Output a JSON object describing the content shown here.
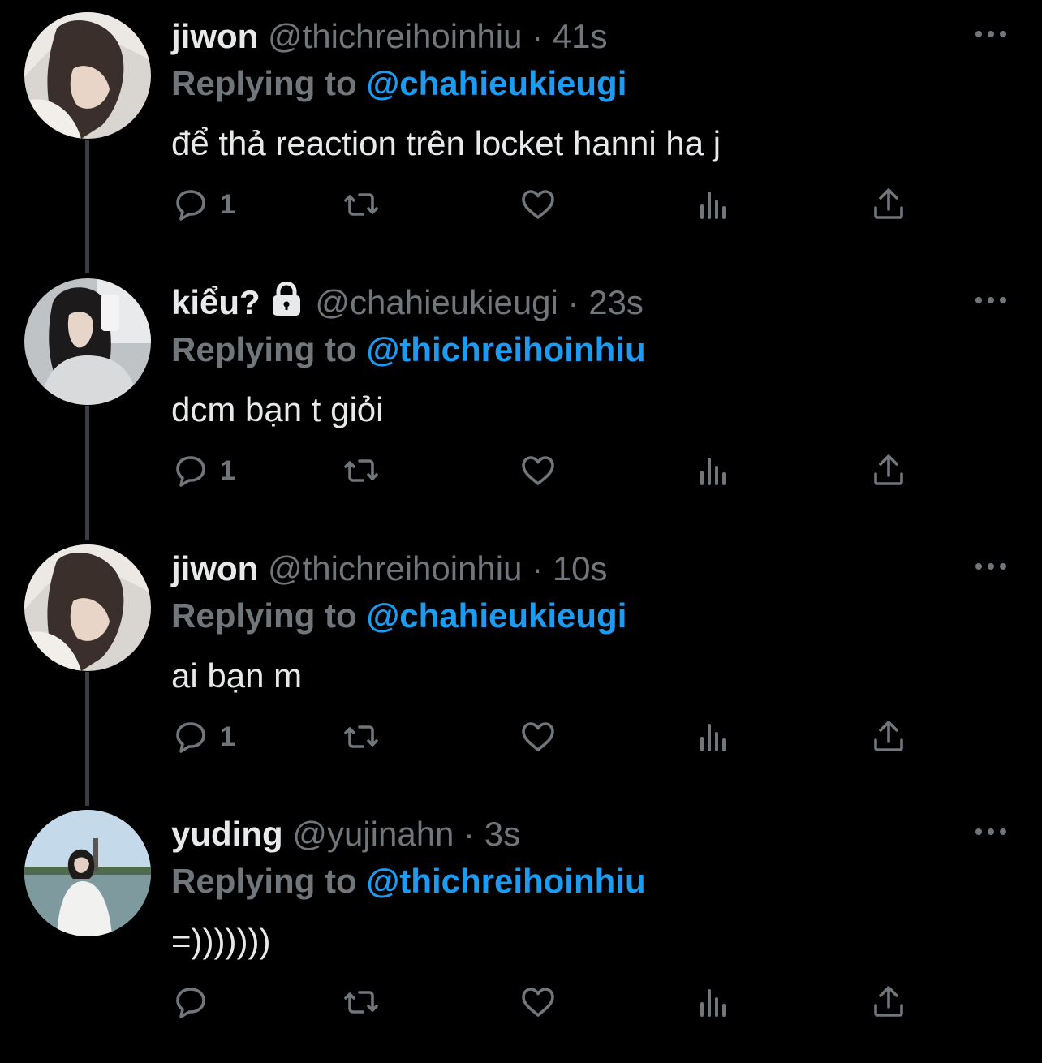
{
  "tweets": [
    {
      "name": "jiwon",
      "handle": "@thichreihoinhiu",
      "time": "41s",
      "locked": false,
      "replying_label": "Replying to",
      "mention": "@chahieukieugi",
      "text": "để thả reaction trên locket hanni ha j",
      "reply_count": "1"
    },
    {
      "name": "kiểu?",
      "handle": "@chahieukieugi",
      "time": "23s",
      "locked": true,
      "replying_label": "Replying to",
      "mention": "@thichreihoinhiu",
      "text": "dcm bạn t giỏi",
      "reply_count": "1"
    },
    {
      "name": "jiwon",
      "handle": "@thichreihoinhiu",
      "time": "10s",
      "locked": false,
      "replying_label": "Replying to",
      "mention": "@chahieukieugi",
      "text": "ai bạn m",
      "reply_count": "1"
    },
    {
      "name": "yuding",
      "handle": "@yujinahn",
      "time": "3s",
      "locked": false,
      "replying_label": "Replying to",
      "mention": "@thichreihoinhiu",
      "text": "=)))))))",
      "reply_count": ""
    }
  ],
  "separator": "·",
  "icons": {
    "reply": "reply-icon",
    "retweet": "retweet-icon",
    "like": "heart-icon",
    "views": "views-icon",
    "share": "share-icon",
    "more": "more-icon",
    "lock": "lock-icon"
  },
  "colors": {
    "background": "#000000",
    "text": "#e7e9ea",
    "secondary": "#71767b",
    "mention": "#1d9bf0",
    "thread_line": "#3a3d41"
  }
}
